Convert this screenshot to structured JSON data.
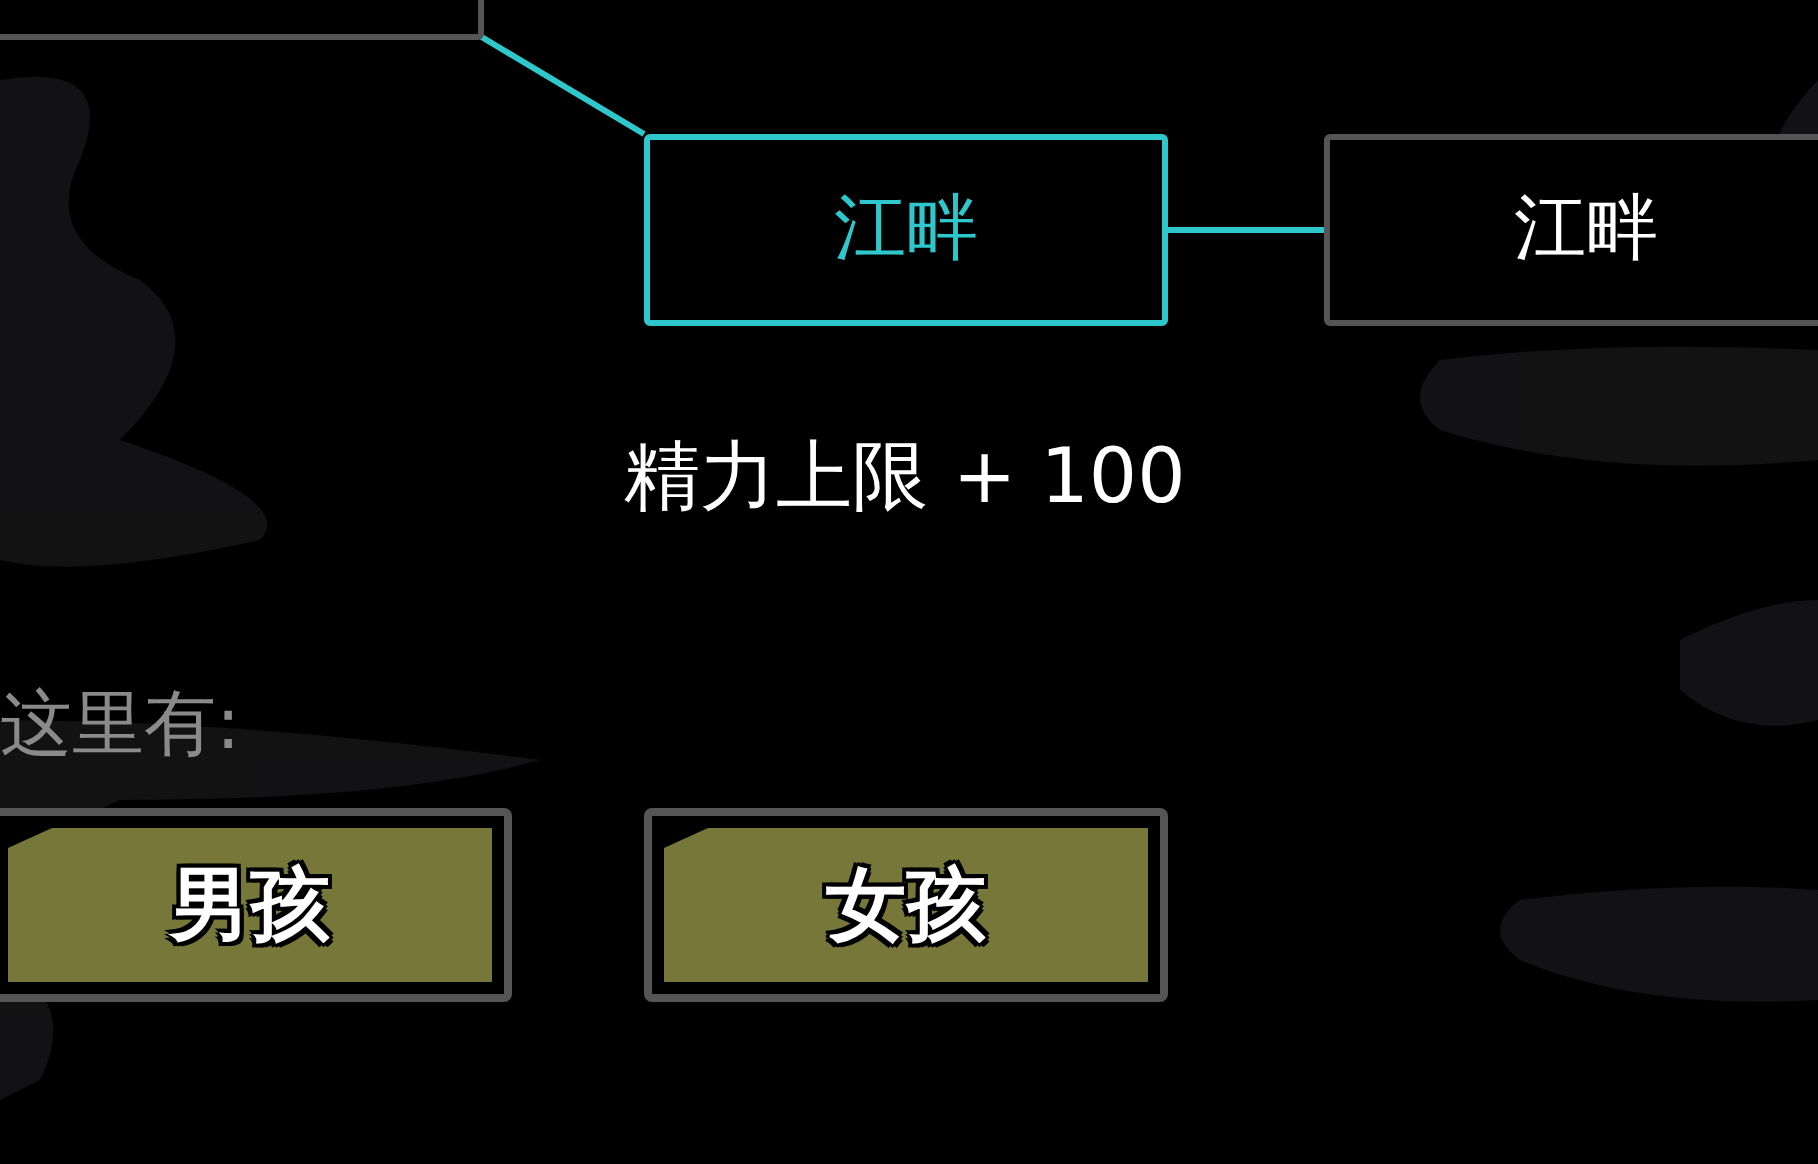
{
  "map": {
    "nodes": [
      {
        "selected": false
      },
      {
        "label": "江畔",
        "selected": true
      },
      {
        "label": "江畔",
        "selected": false
      }
    ]
  },
  "bonus": "精力上限 + 100",
  "here": {
    "label": "这里有:",
    "actions": [
      {
        "label": "男孩"
      },
      {
        "label": "女孩"
      }
    ]
  }
}
